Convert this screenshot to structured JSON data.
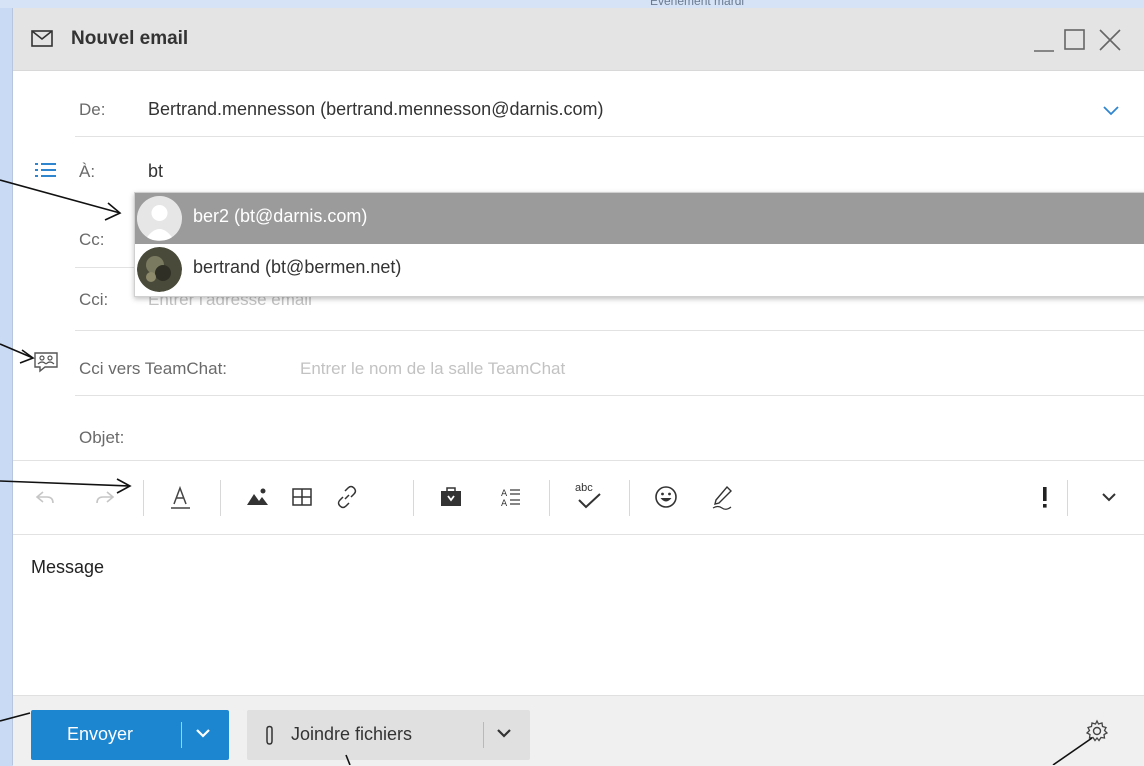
{
  "background": {
    "partial_text": "Evenement mardi"
  },
  "window": {
    "title": "Nouvel email",
    "icons": [
      "mail-icon",
      "minimize-icon",
      "maximize-icon",
      "close-icon"
    ]
  },
  "from": {
    "label": "De:",
    "value": "Bertrand.mennesson (bertrand.mennesson@darnis.com)"
  },
  "to": {
    "label": "À:",
    "value": "bt"
  },
  "cc": {
    "label": "Cc:"
  },
  "bcc": {
    "label": "Cci:",
    "placeholder": "Entrer l'adresse email"
  },
  "teamchat": {
    "label": "Cci vers TeamChat:",
    "placeholder": "Entrer le nom de la salle TeamChat"
  },
  "subject": {
    "label": "Objet:"
  },
  "autocomplete": {
    "items": [
      {
        "text": "ber2 (bt@darnis.com)",
        "selected": true
      },
      {
        "text": "bertrand (bt@bermen.net)",
        "selected": false
      }
    ]
  },
  "toolbar": {
    "icons": [
      "undo-icon",
      "redo-icon",
      "text-format-icon",
      "image-icon",
      "table-icon",
      "link-icon",
      "attachment-box-icon",
      "field-icon",
      "spellcheck-icon",
      "emoji-icon",
      "signature-icon",
      "priority-icon",
      "more-chevron-icon"
    ],
    "spellcheck_text": "abc"
  },
  "message": {
    "placeholder": "Message"
  },
  "footer": {
    "send_label": "Envoyer",
    "attach_label": "Joindre fichiers"
  },
  "colors": {
    "accent": "#1d86d1",
    "selected_row": "#9b9b9b",
    "titlebar": "#e4e4e4"
  }
}
